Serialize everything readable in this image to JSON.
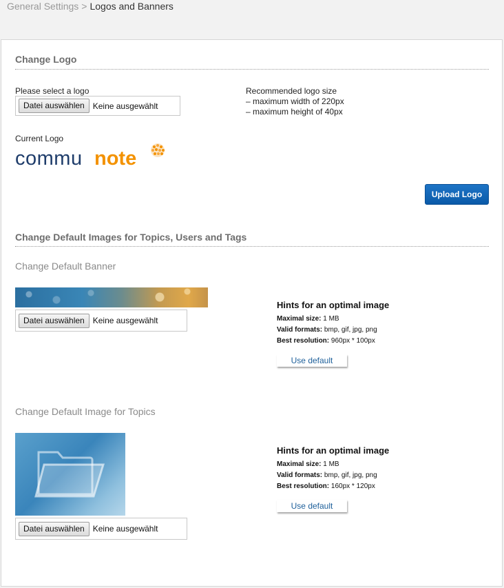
{
  "breadcrumb": {
    "parent": "General Settings",
    "separator": ">",
    "current": "Logos and Banners"
  },
  "logo_section": {
    "title": "Change Logo",
    "select_label": "Please select a logo",
    "file_button": "Datei auswählen",
    "file_status": "Keine ausgewählt",
    "recommended_title": "Recommended logo size",
    "recommended_items": [
      "–  maximum width of 220px",
      "–  maximum height of 40px"
    ],
    "current_logo_label": "Current Logo",
    "logo_text_part1": "commu",
    "logo_text_part2": "note",
    "upload_button": "Upload Logo",
    "colors": {
      "logo_dark": "#1f3d6b",
      "logo_orange": "#f39200",
      "primary_button": "#0a5aa8"
    }
  },
  "defaults_section": {
    "title": "Change Default Images for Topics, Users and Tags",
    "banner": {
      "title": "Change Default Banner",
      "file_button": "Datei auswählen",
      "file_status": "Keine ausgewählt",
      "hints_title": "Hints for an optimal image",
      "max_size_label": "Maximal size:",
      "max_size_value": "1 MB",
      "formats_label": "Valid formats:",
      "formats_value": "bmp, gif, jpg, png",
      "resolution_label": "Best resolution:",
      "resolution_value": "960px * 100px",
      "default_button": "Use default"
    },
    "topics": {
      "title": "Change Default Image for Topics",
      "file_button": "Datei auswählen",
      "file_status": "Keine ausgewählt",
      "hints_title": "Hints for an optimal image",
      "max_size_label": "Maximal size:",
      "max_size_value": "1 MB",
      "formats_label": "Valid formats:",
      "formats_value": "bmp, gif, jpg, png",
      "resolution_label": "Best resolution:",
      "resolution_value": "160px * 120px",
      "default_button": "Use default"
    }
  }
}
